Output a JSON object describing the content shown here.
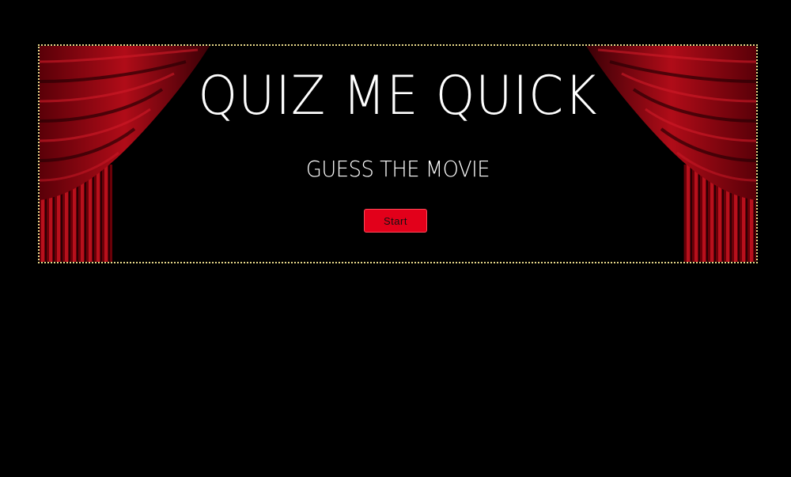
{
  "banner": {
    "title": "QUIZ ME QUICK",
    "subtitle": "GUESS THE MOVIE",
    "start_label": "Start"
  },
  "colors": {
    "background": "#000000",
    "border": "#e8d98a",
    "button": "#e2001a",
    "curtain_dark": "#3a0006",
    "curtain_mid": "#8a0010",
    "curtain_light": "#c8101e"
  }
}
